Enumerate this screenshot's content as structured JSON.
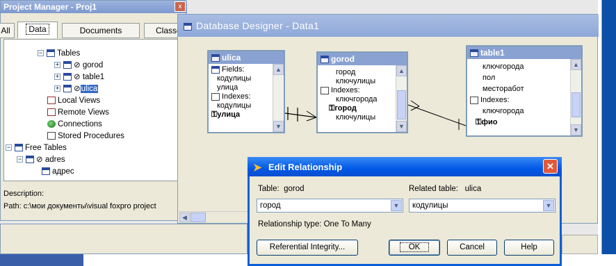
{
  "project_manager": {
    "title": "Project Manager - Proj1",
    "close_glyph": "x",
    "tabs": [
      {
        "label": "All",
        "selected": false
      },
      {
        "label": "Data",
        "selected": true
      },
      {
        "label": "Documents",
        "selected": false
      },
      {
        "label": "Classe",
        "selected": false
      }
    ],
    "tree": {
      "tables": "Tables",
      "table_items": [
        "⊘ gorod",
        "⊘ table1",
        "⊘"
      ],
      "selected_item": "ulica",
      "local_views": "Local Views",
      "remote_views": "Remote Views",
      "connections": "Connections",
      "stored_procedures": "Stored Procedures",
      "free_tables": "Free Tables",
      "adres": "⊘ adres",
      "adres_child": "адрес"
    },
    "description_label": "Description:",
    "path_text": "Path: c:\\мои документы\\visual foxpro project"
  },
  "database_designer": {
    "title": "Database Designer - Data1",
    "tables": [
      {
        "name": "ulica",
        "rows": [
          "Fields:",
          "кодулицы",
          "улица",
          "Indexes:",
          "кодулицы"
        ],
        "key": "улица"
      },
      {
        "name": "gorod",
        "rows": [
          "город",
          "ключулицы",
          "Indexes:",
          "ключгорода"
        ],
        "key": "город",
        "after_key": [
          "ключулицы"
        ]
      },
      {
        "name": "table1",
        "rows": [
          "ключгорода",
          "пол",
          "месторабот",
          "Indexes:",
          "ключгорода"
        ],
        "key": "фио"
      }
    ]
  },
  "dialog": {
    "title": "Edit Relationship",
    "table_label": "Table:",
    "table_value": "gorod",
    "related_label": "Related table:",
    "related_value": "ulica",
    "left_combo": "город",
    "right_combo": "кодулицы",
    "relationship_type": "Relationship type:  One To Many",
    "buttons": {
      "ref": "Referential Integrity...",
      "ok": "OK",
      "cancel": "Cancel",
      "help": "Help"
    }
  },
  "colors": {
    "accent": "#0058e6",
    "frame": "#0b4fa8",
    "designer_title": "#8ea8d8"
  }
}
